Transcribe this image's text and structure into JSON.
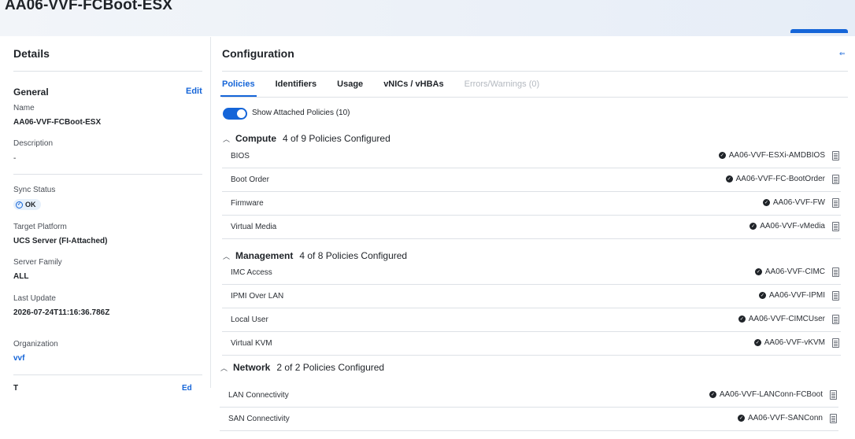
{
  "page": {
    "title": "AA06-VVF-FCBoot-ESX"
  },
  "details": {
    "title": "Details",
    "general": {
      "title": "General",
      "edit_label": "Edit"
    },
    "name": {
      "label": "Name",
      "value": "AA06-VVF-FCBoot-ESX"
    },
    "description": {
      "label": "Description",
      "value": "-"
    },
    "sync_status": {
      "label": "Sync Status",
      "value": "OK"
    },
    "target_platform": {
      "label": "Target Platform",
      "value": "UCS Server (FI-Attached)"
    },
    "server_family": {
      "label": "Server Family",
      "value": "ALL"
    },
    "last_update": {
      "label": "Last Update",
      "value": "2026-07-24T11:16:36.786Z"
    },
    "organization": {
      "label": "Organization",
      "value": "vvf"
    },
    "cutoff_title": "T",
    "cutoff_edit": "Ed"
  },
  "configuration": {
    "title": "Configuration",
    "tabs": [
      {
        "label": "Policies",
        "state": "active"
      },
      {
        "label": "Identifiers",
        "state": "normal"
      },
      {
        "label": "Usage",
        "state": "normal"
      },
      {
        "label": "vNICs / vHBAs",
        "state": "normal"
      },
      {
        "label": "Errors/Warnings (0)",
        "state": "disabled"
      }
    ],
    "toggle": {
      "label": "Show Attached Policies (10)",
      "on": true
    },
    "groups": [
      {
        "name": "Compute",
        "count": "4 of 9 Policies Configured",
        "rows": [
          {
            "label": "BIOS",
            "value": "AA06-VVF-ESXi-AMDBIOS"
          },
          {
            "label": "Boot Order",
            "value": "AA06-VVF-FC-BootOrder"
          },
          {
            "label": "Firmware",
            "value": "AA06-VVF-FW"
          },
          {
            "label": "Virtual Media",
            "value": "AA06-VVF-vMedia"
          }
        ]
      },
      {
        "name": "Management",
        "count": "4 of 8 Policies Configured",
        "rows": [
          {
            "label": "IMC Access",
            "value": "AA06-VVF-CIMC"
          },
          {
            "label": "IPMI Over LAN",
            "value": "AA06-VVF-IPMI"
          },
          {
            "label": "Local User",
            "value": "AA06-VVF-CIMCUser"
          },
          {
            "label": "Virtual KVM",
            "value": "AA06-VVF-vKVM"
          }
        ]
      },
      {
        "name": "Network",
        "count": "2 of 2 Policies Configured",
        "rows": [
          {
            "label": "LAN Connectivity",
            "value": "AA06-VVF-LANConn-FCBoot"
          },
          {
            "label": "SAN Connectivity",
            "value": "AA06-VVF-SANConn"
          }
        ]
      }
    ]
  },
  "icons": {
    "policy_status": "check-circle-icon",
    "policy_detail": "document-icon",
    "group_toggle": "chevron-up-icon",
    "collapse": "collapse-panel-icon"
  },
  "colors": {
    "accent": "#1565d8",
    "disabled": "#b4b9c0"
  }
}
